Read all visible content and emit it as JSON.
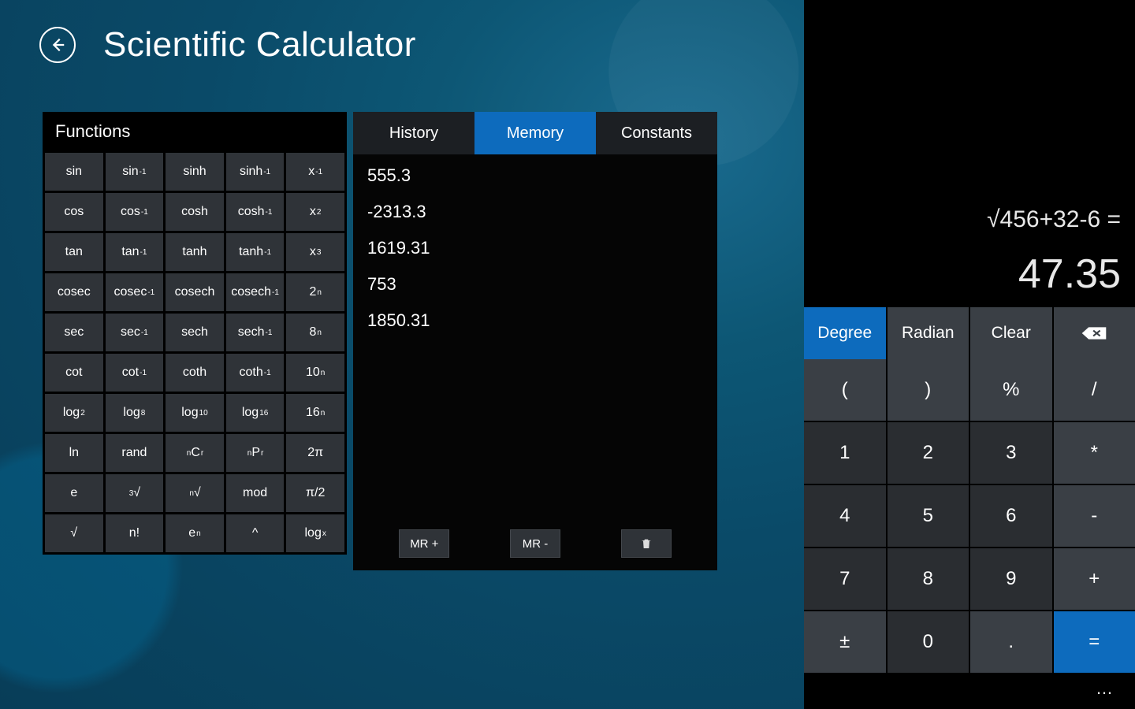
{
  "header": {
    "title": "Scientific Calculator"
  },
  "functions": {
    "title": "Functions",
    "rows": [
      [
        "sin",
        "sin⁻¹",
        "sinh",
        "sinh⁻¹",
        "x⁻¹"
      ],
      [
        "cos",
        "cos⁻¹",
        "cosh",
        "cosh⁻¹",
        "x²"
      ],
      [
        "tan",
        "tan⁻¹",
        "tanh",
        "tanh⁻¹",
        "x³"
      ],
      [
        "cosec",
        "cosec⁻¹",
        "cosech",
        "cosech⁻¹",
        "2ⁿ"
      ],
      [
        "sec",
        "sec⁻¹",
        "sech",
        "sech⁻¹",
        "8ⁿ"
      ],
      [
        "cot",
        "cot⁻¹",
        "coth",
        "coth⁻¹",
        "10ⁿ"
      ],
      [
        "log₂",
        "log₈",
        "log₁₀",
        "log₁₆",
        "16ⁿ"
      ],
      [
        "ln",
        "rand",
        "ⁿCᵣ",
        "ⁿPᵣ",
        "2π"
      ],
      [
        "e",
        "³√",
        "ⁿ√",
        "mod",
        "π/2"
      ],
      [
        "√",
        "n!",
        "eⁿ",
        "^",
        "logₓ"
      ]
    ]
  },
  "memory": {
    "tabs": [
      "History",
      "Memory",
      "Constants"
    ],
    "active_tab": "Memory",
    "items": [
      "555.3",
      "-2313.3",
      "1619.31",
      "753",
      "1850.31"
    ],
    "actions": {
      "mr_plus": "MR +",
      "mr_minus": "MR -"
    }
  },
  "display": {
    "expression": "√456+32-6 =",
    "result": "47.35"
  },
  "keypad": {
    "row_mode": {
      "degree": "Degree",
      "radian": "Radian",
      "clear": "Clear"
    },
    "rows": [
      [
        "(",
        ")",
        "%",
        "/"
      ],
      [
        "1",
        "2",
        "3",
        "*"
      ],
      [
        "4",
        "5",
        "6",
        "-"
      ],
      [
        "7",
        "8",
        "9",
        "+"
      ],
      [
        "±",
        "0",
        ".",
        "="
      ]
    ]
  },
  "more": "…"
}
